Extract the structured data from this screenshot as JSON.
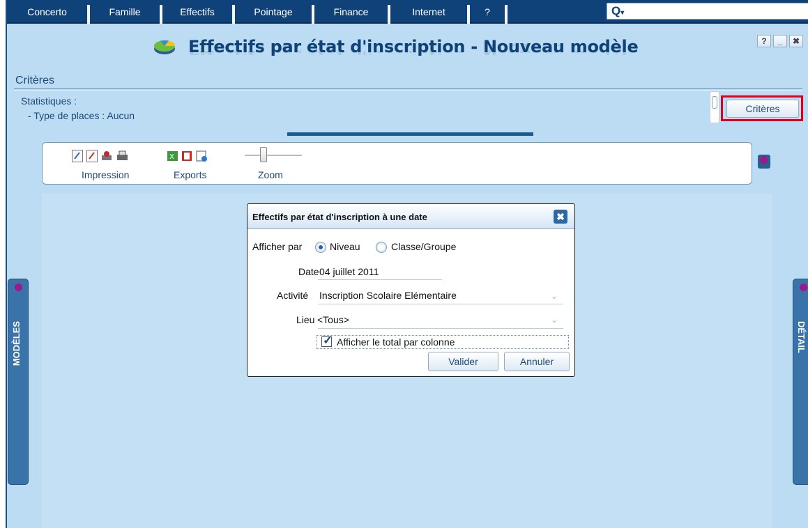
{
  "menu": {
    "items": [
      "Concerto",
      "Famille",
      "Effectifs",
      "Pointage",
      "Finance",
      "Internet",
      "?"
    ]
  },
  "search": {
    "icon": "search-icon"
  },
  "window": {
    "title": "Effectifs par état d'inscription - Nouveau modèle",
    "buttons": [
      "?",
      "_",
      "✖"
    ]
  },
  "criteria": {
    "heading": "Critères",
    "stat_label": "Statistiques :",
    "stat_item": "- Type de places : Aucun",
    "button": "Critères"
  },
  "toolbar": {
    "print_label": "Impression",
    "export_label": "Exports",
    "zoom_label": "Zoom"
  },
  "side": {
    "left": "MODÈLES",
    "right": "DÉTAIL"
  },
  "dialog": {
    "title": "Effectifs par état d'inscription à une date",
    "show_by_label": "Afficher par",
    "radio_level": "Niveau",
    "radio_class": "Classe/Groupe",
    "date_label": "Date",
    "date_value": "04 juillet 2011",
    "activity_label": "Activité",
    "activity_value": "Inscription Scolaire Elémentaire",
    "place_label": "Lieu",
    "place_value": "<Tous>",
    "checkbox_label": "Afficher le total par colonne",
    "validate": "Valider",
    "cancel": "Annuler"
  },
  "colors": {
    "menubar": "#10427a",
    "background": "#bcdcf3",
    "accent": "#1e4a78",
    "highlight": "#e0001b"
  }
}
